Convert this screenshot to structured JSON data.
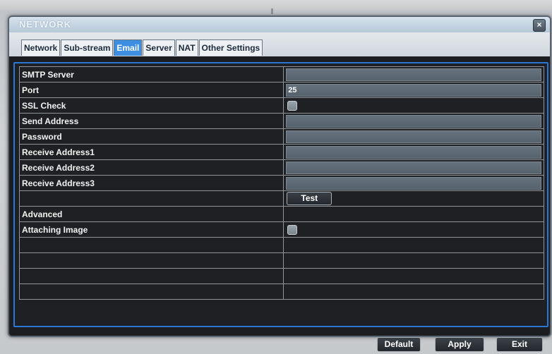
{
  "window": {
    "title": "NETWORK",
    "close_glyph": "×"
  },
  "tabs": [
    {
      "label": "Network",
      "active": false
    },
    {
      "label": "Sub-stream",
      "active": false
    },
    {
      "label": "Email",
      "active": true
    },
    {
      "label": "Server",
      "active": false
    },
    {
      "label": "NAT",
      "active": false
    },
    {
      "label": "Other Settings",
      "active": false
    }
  ],
  "rows": {
    "smtp_server": {
      "label": "SMTP Server",
      "value": ""
    },
    "port": {
      "label": "Port",
      "value": "25"
    },
    "ssl_check": {
      "label": "SSL Check",
      "checked": false
    },
    "send_address": {
      "label": "Send Address",
      "value": ""
    },
    "password": {
      "label": "Password",
      "value": ""
    },
    "receive1": {
      "label": "Receive Address1",
      "value": ""
    },
    "receive2": {
      "label": "Receive Address2",
      "value": ""
    },
    "receive3": {
      "label": "Receive Address3",
      "value": ""
    },
    "test_button": "Test",
    "advanced": {
      "label": "Advanced"
    },
    "attaching_image": {
      "label": "Attaching Image",
      "checked": false
    }
  },
  "footer": {
    "default_label": "Default",
    "apply_label": "Apply",
    "exit_label": "Exit"
  },
  "colors": {
    "accent": "#3d8ee0",
    "panel_border": "#2b78d4",
    "background": "#1e2024"
  }
}
